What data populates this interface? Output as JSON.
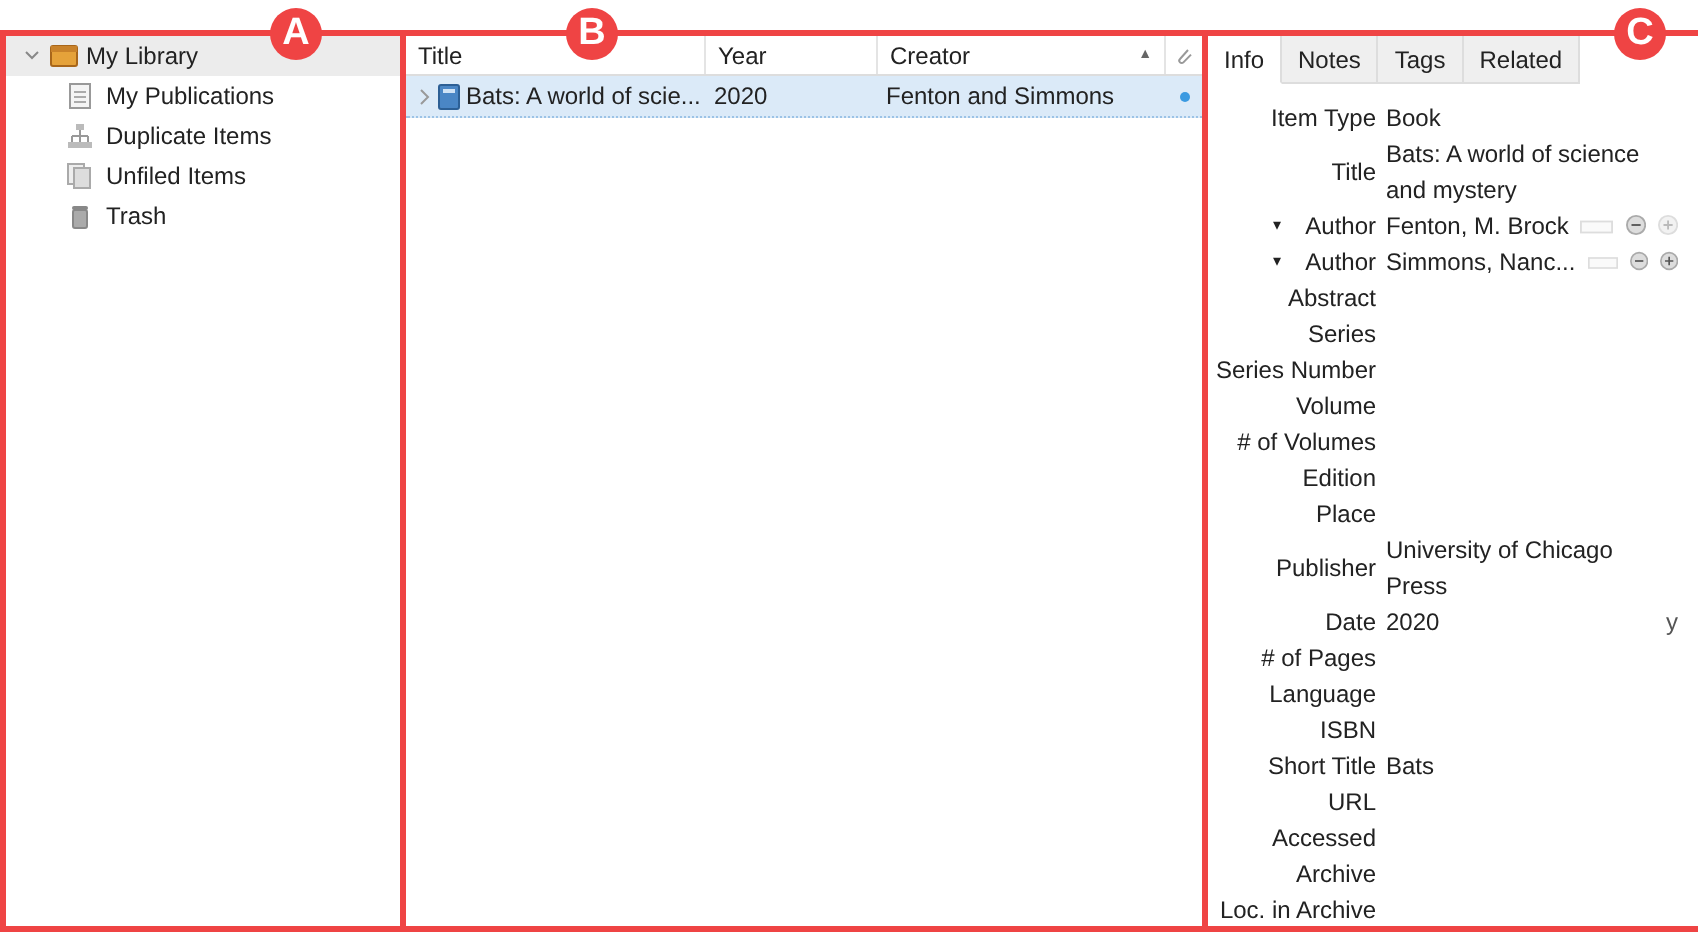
{
  "markers": [
    "A",
    "B",
    "C"
  ],
  "library": {
    "label": "My Library",
    "expanded": true,
    "selected": true,
    "children": [
      {
        "label": "My Publications",
        "selected": false
      },
      {
        "label": "Duplicate Items",
        "selected": false
      },
      {
        "label": "Unfiled Items",
        "selected": false
      },
      {
        "label": "Trash",
        "selected": false
      }
    ]
  },
  "items_table": {
    "columns": [
      "Title",
      "Year",
      "Creator"
    ],
    "sort_indicator": "▲",
    "rows": [
      {
        "title": "Bats: A world of scie...",
        "year": "2020",
        "creator": "Fenton and Simmons",
        "selected": true,
        "has_attachment": true
      }
    ]
  },
  "item_pane": {
    "tabs": [
      {
        "label": "Info",
        "selected": true
      },
      {
        "label": "Notes",
        "selected": false
      },
      {
        "label": "Tags",
        "selected": false
      },
      {
        "label": "Related",
        "selected": false
      }
    ],
    "fields": [
      {
        "kind": "field",
        "label": "Item Type",
        "value": "Book"
      },
      {
        "kind": "field",
        "label": "Title",
        "value": "Bats: A world of science and mystery"
      },
      {
        "kind": "author",
        "expander": "▾",
        "label": "Author",
        "value": "Fenton, M. Brock",
        "plus_enabled": false
      },
      {
        "kind": "author",
        "expander": "▾",
        "label": "Author",
        "value": "Simmons, Nanc...",
        "plus_enabled": true
      },
      {
        "kind": "field",
        "label": "Abstract"
      },
      {
        "kind": "field",
        "label": "Series"
      },
      {
        "kind": "field",
        "label": "Series Number"
      },
      {
        "kind": "field",
        "label": "Volume"
      },
      {
        "kind": "field",
        "label": "# of Volumes"
      },
      {
        "kind": "field",
        "label": "Edition"
      },
      {
        "kind": "field",
        "label": "Place"
      },
      {
        "kind": "field",
        "label": "Publisher",
        "value": "University of Chicago Press"
      },
      {
        "kind": "date",
        "label": "Date",
        "value": "2020",
        "format": "y"
      },
      {
        "kind": "field",
        "label": "# of Pages"
      },
      {
        "kind": "field",
        "label": "Language"
      },
      {
        "kind": "field",
        "label": "ISBN"
      },
      {
        "kind": "field",
        "label": "Short Title",
        "value": "Bats"
      },
      {
        "kind": "field",
        "label": "URL"
      },
      {
        "kind": "field",
        "label": "Accessed"
      },
      {
        "kind": "field",
        "label": "Archive"
      },
      {
        "kind": "field",
        "label": "Loc. in Archive"
      }
    ]
  }
}
